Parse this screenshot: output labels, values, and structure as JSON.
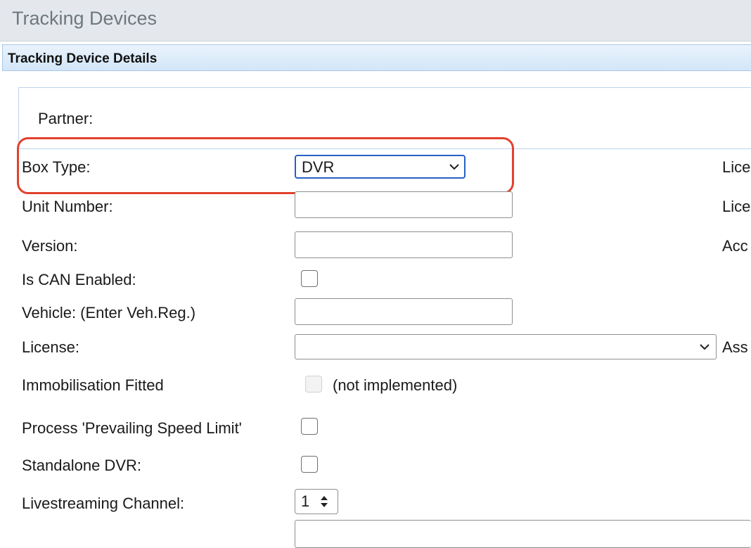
{
  "page": {
    "title": "Tracking Devices"
  },
  "section": {
    "title": "Tracking Device Details"
  },
  "form": {
    "partner_label": "Partner:",
    "box_type_label": "Box Type:",
    "box_type_value": "DVR",
    "unit_number_label": "Unit Number:",
    "unit_number_value": "",
    "version_label": "Version:",
    "version_value": "",
    "can_enabled_label": "Is CAN Enabled:",
    "vehicle_label": "Vehicle: (Enter Veh.Reg.)",
    "vehicle_value": "",
    "license_label": "License:",
    "license_value": "",
    "immobilisation_label": "Immobilisation Fitted",
    "immobilisation_note": "(not implemented)",
    "speed_limit_label": "Process 'Prevailing Speed Limit'",
    "standalone_dvr_label": "Standalone DVR:",
    "livestream_label": "Livestreaming Channel:",
    "livestream_value": "1"
  },
  "right_column": {
    "row1": "Lice",
    "row2": "Lice",
    "row3": "Acc",
    "row4": "Ass"
  },
  "colors": {
    "highlight": "#e2412e",
    "focus": "#2660c6"
  }
}
